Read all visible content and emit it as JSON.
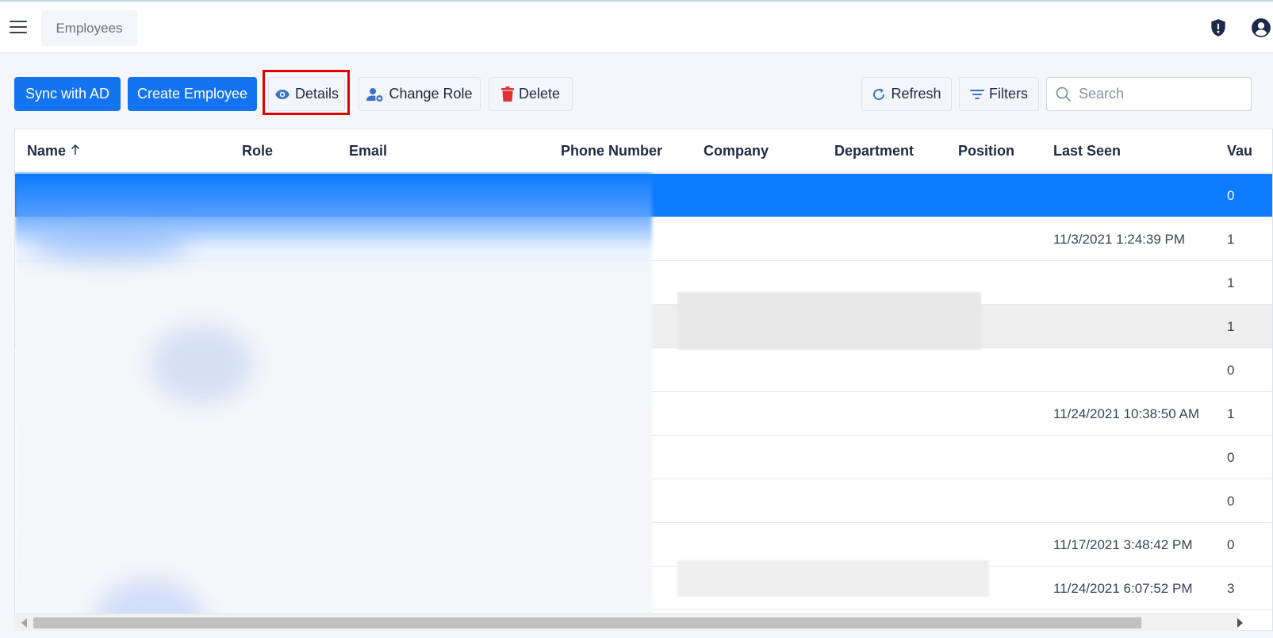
{
  "header": {
    "breadcrumb": "Employees",
    "icons": [
      "menu-icon",
      "shield-alert-icon",
      "user-account-icon"
    ]
  },
  "toolbar": {
    "sync_label": "Sync with AD",
    "create_label": "Create Employee",
    "details_label": "Details",
    "change_role_label": "Change Role",
    "delete_label": "Delete",
    "refresh_label": "Refresh",
    "filters_label": "Filters",
    "search_placeholder": "Search"
  },
  "table": {
    "columns": [
      "Name",
      "Role",
      "Email",
      "Phone Number",
      "Company",
      "Department",
      "Position",
      "Last Seen",
      "Vau"
    ],
    "sorted_column": "Name",
    "sort_direction": "ascending",
    "rows": [
      {
        "last_seen": "",
        "vault": "0",
        "selected": true
      },
      {
        "last_seen": "11/3/2021 1:24:39 PM",
        "vault": "1"
      },
      {
        "last_seen": "",
        "vault": "1"
      },
      {
        "last_seen": "",
        "vault": "1",
        "hover": true
      },
      {
        "last_seen": "",
        "vault": "0"
      },
      {
        "last_seen": "11/24/2021 10:38:50 AM",
        "vault": "1"
      },
      {
        "last_seen": "",
        "vault": "0"
      },
      {
        "last_seen": "",
        "vault": "0"
      },
      {
        "last_seen": "11/17/2021 3:48:42 PM",
        "vault": "0"
      },
      {
        "last_seen": "11/24/2021 6:07:52 PM",
        "vault": "3"
      }
    ]
  },
  "colors": {
    "primary": "#1473f0",
    "selected_row": "#0b7bff",
    "highlight_box": "#e00000",
    "delete_icon": "#e03131"
  }
}
